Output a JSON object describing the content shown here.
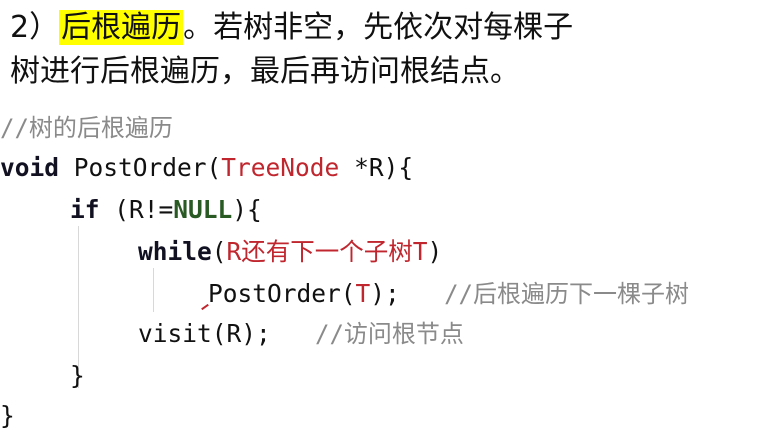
{
  "heading": {
    "prefix": "2）",
    "highlight": "后根遍历",
    "line1_rest": "。若树非空，先依次对每棵子",
    "line2": "树进行后根遍历，最后再访问根结点。"
  },
  "code": {
    "comment_title": "//树的后根遍历",
    "void_kw": "void",
    "func_name": "PostOrder(",
    "param_type": "TreeNode",
    "param_rest": " *R){",
    "if_kw": "if",
    "if_open": " (R!=",
    "null_kw": "NULL",
    "if_close": "){",
    "while_kw": "while",
    "while_open": "(",
    "while_cond": "R还有下一个子树T",
    "while_close": ")",
    "call_name": "PostOrder(",
    "call_arg": "T",
    "call_end": ");",
    "call_comment": "//后根遍历下一棵子树",
    "visit": "visit(R);",
    "visit_comment": "//访问根节点",
    "close_inner": "}",
    "close_outer": "}"
  }
}
